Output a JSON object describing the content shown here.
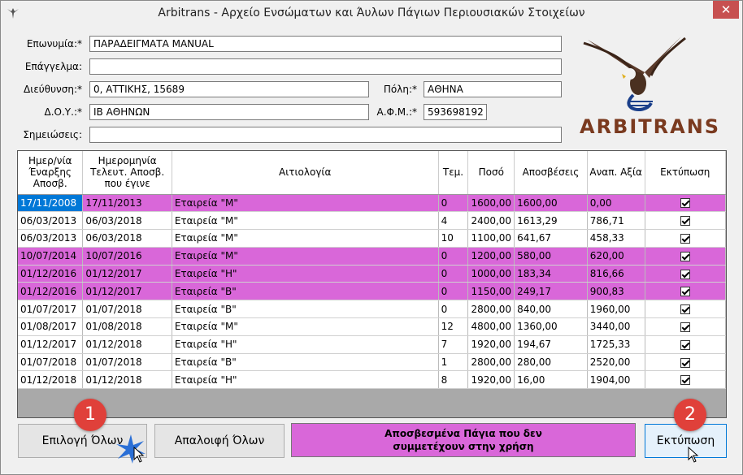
{
  "window": {
    "title": "Arbitrans - Αρχείο Ενσώματων και Άυλων Πάγιων Περιουσιακών Στοιχείων",
    "close": "✕"
  },
  "form": {
    "eponymia_label": "Επωνυμία:*",
    "eponymia_value": "ΠΑΡΑΔΕΙΓΜΑΤΑ MANUAL",
    "epaggelma_label": "Επάγγελμα:",
    "epaggelma_value": "",
    "dieythynsi_label": "Διεύθυνση:*",
    "dieythynsi_value": "0, ΑΤΤΙΚΗΣ, 15689",
    "poli_label": "Πόλη:*",
    "poli_value": "ΑΘΗΝΑ",
    "doy_label": "Δ.Ο.Υ.:*",
    "doy_value": "ΙΒ ΑΘΗΝΩΝ",
    "afm_label": "Α.Φ.Μ.:*",
    "afm_value": "593698192",
    "simeioseis_label": "Σημειώσεις:",
    "simeioseis_value": ""
  },
  "logo": {
    "text": "ARBITRANS",
    "icon": "eagle-logo-icon"
  },
  "table": {
    "headers": [
      "Ημερ/νία Έναρξης Αποσβ.",
      "Ημερομηνία Τελευτ. Αποσβ. που έγινε",
      "Αιτιολογία",
      "Τεμ.",
      "Ποσό",
      "Αποσβέσεις",
      "Αναπ. Αξία",
      "Εκτύπωση"
    ],
    "rows": [
      {
        "c": [
          "17/11/2008",
          "17/11/2013",
          "Εταιρεία \"Μ\"",
          "0",
          "1600,00",
          "1600,00",
          "0,00"
        ],
        "pink": true,
        "selected": true
      },
      {
        "c": [
          "06/03/2013",
          "06/03/2018",
          "Εταιρεία \"Μ\"",
          "4",
          "2400,00",
          "1613,29",
          "786,71"
        ],
        "pink": false
      },
      {
        "c": [
          "06/03/2013",
          "06/03/2018",
          "Εταιρεία \"Μ\"",
          "10",
          "1100,00",
          "641,67",
          "458,33"
        ],
        "pink": false
      },
      {
        "c": [
          "10/07/2014",
          "10/07/2016",
          "Εταιρεία \"Μ\"",
          "0",
          "1200,00",
          "580,00",
          "620,00"
        ],
        "pink": true
      },
      {
        "c": [
          "01/12/2016",
          "01/12/2017",
          "Εταιρεία \"Η\"",
          "0",
          "1000,00",
          "183,34",
          "816,66"
        ],
        "pink": true
      },
      {
        "c": [
          "01/12/2016",
          "01/12/2017",
          "Εταιρεία \"Β\"",
          "0",
          "1150,00",
          "249,17",
          "900,83"
        ],
        "pink": true
      },
      {
        "c": [
          "01/07/2017",
          "01/07/2018",
          "Εταιρεία \"Β\"",
          "0",
          "2800,00",
          "840,00",
          "1960,00"
        ],
        "pink": false
      },
      {
        "c": [
          "01/08/2017",
          "01/08/2018",
          "Εταιρεία \"Μ\"",
          "12",
          "4800,00",
          "1360,00",
          "3440,00"
        ],
        "pink": false
      },
      {
        "c": [
          "01/12/2017",
          "01/12/2018",
          "Εταιρεία \"Η\"",
          "7",
          "1920,00",
          "194,67",
          "1725,33"
        ],
        "pink": false
      },
      {
        "c": [
          "01/07/2018",
          "01/07/2018",
          "Εταιρεία \"Β\"",
          "1",
          "2800,00",
          "280,00",
          "2520,00"
        ],
        "pink": false
      },
      {
        "c": [
          "01/12/2018",
          "01/12/2018",
          "Εταιρεία \"Η\"",
          "8",
          "1920,00",
          "16,00",
          "1904,00"
        ],
        "pink": false
      }
    ],
    "pink_color": "#d967d9"
  },
  "buttons": {
    "select_all": "Επιλογή Όλων",
    "deselect_all": "Απαλοιφή Όλων",
    "print": "Εκτύπωση"
  },
  "legend": {
    "line1": "Αποσβεσμένα Πάγια που δεν",
    "line2": "συμμετέχουν στην χρήση"
  },
  "badges": {
    "one": "1",
    "two": "2"
  }
}
